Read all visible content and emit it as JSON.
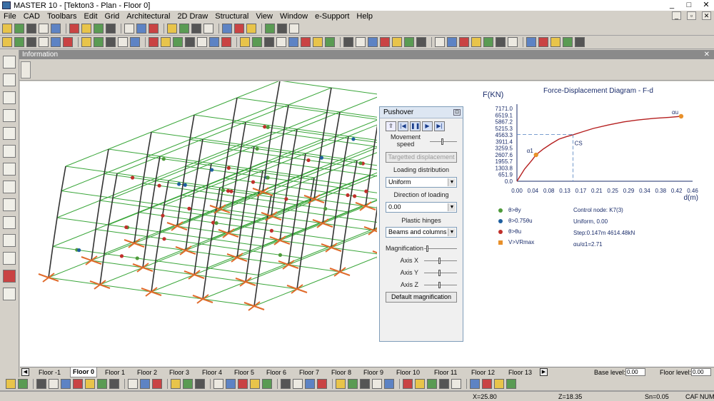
{
  "window": {
    "title": "MASTER 10 - [Tekton3 - Plan - Floor 0]"
  },
  "menu": [
    "File",
    "CAD",
    "Toolbars",
    "Edit",
    "Grid",
    "Architectural",
    "2D Draw",
    "Structural",
    "View",
    "Window",
    "e-Support",
    "Help"
  ],
  "info_panel": {
    "title": "Information"
  },
  "pushover": {
    "title": "Pushover",
    "movement_speed_label": "Movement\nspeed",
    "targeted_button": "Targetted displacement",
    "loading_distribution_label": "Loading distribution",
    "loading_distribution_value": "Uniform",
    "direction_label": "Direction of loading",
    "direction_value": "0.00",
    "plastic_hinges_label": "Plastic hinges",
    "plastic_hinges_value": "Beams and columns",
    "magnification_label": "Magnification",
    "axis_x": "Axis X",
    "axis_y": "Axis Y",
    "axis_z": "Axis Z",
    "default_button": "Default magnification"
  },
  "chart_data": {
    "type": "line",
    "title": "Force-Displacement Diagram - F-d",
    "ylabel": "F(KN)",
    "xlabel": "d(m)",
    "y_ticks": [
      "7171.0",
      "6519.1",
      "5867.2",
      "5215.3",
      "4563.3",
      "3911.4",
      "3259.5",
      "2607.6",
      "1955.7",
      "1303.8",
      "651.9",
      "0.0"
    ],
    "x_ticks": [
      "0.00",
      "0.04",
      "0.08",
      "0.13",
      "0.17",
      "0.21",
      "0.25",
      "0.29",
      "0.34",
      "0.38",
      "0.42",
      "0.46"
    ],
    "ylim": [
      0,
      7171
    ],
    "xlim": [
      0,
      0.46
    ],
    "series": [
      {
        "x": [
          0,
          0.02,
          0.04,
          0.05,
          0.07,
          0.09,
          0.11,
          0.13,
          0.15,
          0.17,
          0.2,
          0.24,
          0.28,
          0.32,
          0.36,
          0.4,
          0.43
        ],
        "y": [
          0,
          1200,
          2100,
          2600,
          3200,
          3700,
          4150,
          4400,
          4614,
          4850,
          5200,
          5550,
          5850,
          6050,
          6200,
          6300,
          6400
        ]
      }
    ],
    "points": [
      {
        "label": "α1",
        "x": 0.05,
        "y": 2600
      },
      {
        "label": "αu",
        "x": 0.43,
        "y": 6400
      }
    ],
    "cs": {
      "label": "CS",
      "x": 0.147,
      "y": 4614
    },
    "legend": [
      {
        "label": "θ>θy",
        "color": "#4e9a3a"
      },
      {
        "label": "θ>0.75θu",
        "color": "#1f5fa0"
      },
      {
        "label": "θ>θu",
        "color": "#c0302b"
      },
      {
        "label": "V>VRmax",
        "color": "#e8902a"
      }
    ],
    "notes": [
      "Control node: K7(3)",
      "Uniform, 0.00",
      "Step:0.147m 4614.48kN",
      "αu/α1=2.71"
    ]
  },
  "floor_tabs": [
    "Floor -1",
    "Floor 0",
    "Floor 1",
    "Floor 2",
    "Floor 3",
    "Floor 4",
    "Floor 5",
    "Floor 6",
    "Floor 7",
    "Floor 8",
    "Floor 9",
    "Floor 10",
    "Floor 11",
    "Floor 12",
    "Floor 13"
  ],
  "base_level_label": "Base level:",
  "base_level_value": "0.00",
  "floor_level_label": "Floor level:",
  "floor_level_value": "0.00",
  "status": {
    "x": "X=25.80",
    "z": "Z=18.35",
    "sn": "Sn=0.05",
    "caf": "CAF",
    "num": "NUM"
  }
}
